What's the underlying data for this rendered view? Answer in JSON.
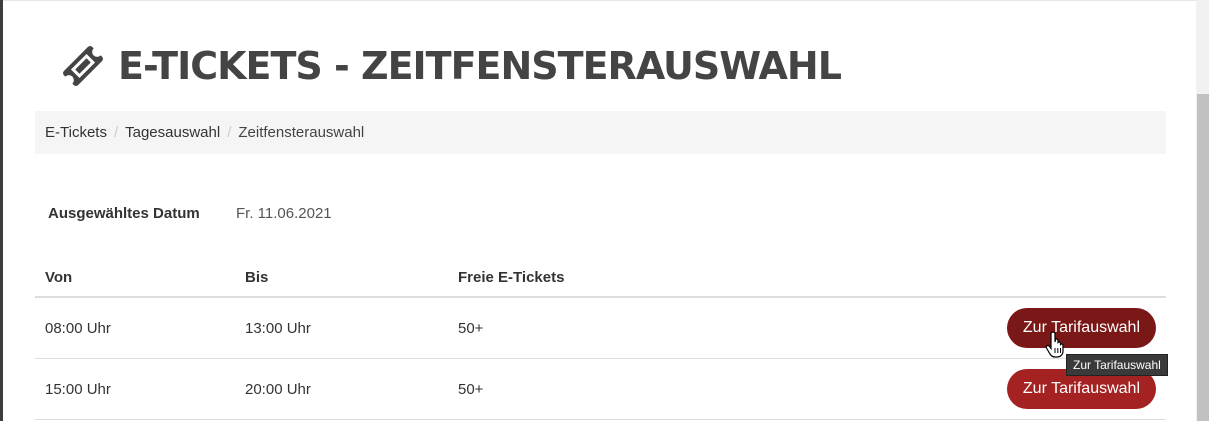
{
  "page": {
    "title": "E-TICKETS - ZEITFENSTERAUSWAHL"
  },
  "breadcrumb": [
    "E-Tickets",
    "Tagesauswahl",
    "Zeitfensterauswahl"
  ],
  "selection": {
    "label": "Ausgewähltes Datum",
    "value": "Fr. 11.06.2021"
  },
  "table": {
    "columns": [
      "Von",
      "Bis",
      "Freie E-Tickets"
    ],
    "rows": [
      {
        "von": "08:00 Uhr",
        "bis": "13:00 Uhr",
        "free": "50+",
        "button": "Zur Tarifauswahl"
      },
      {
        "von": "15:00 Uhr",
        "bis": "20:00 Uhr",
        "free": "50+",
        "button": "Zur Tarifauswahl"
      }
    ]
  },
  "tooltip": {
    "text": "Zur Tarifauswahl"
  },
  "colors": {
    "accent": "#a52222",
    "accent_hover": "#7a1717",
    "title": "#444444"
  },
  "icons": {
    "title_icon": "ticket-icon",
    "cursor": "hand-pointer-icon"
  }
}
